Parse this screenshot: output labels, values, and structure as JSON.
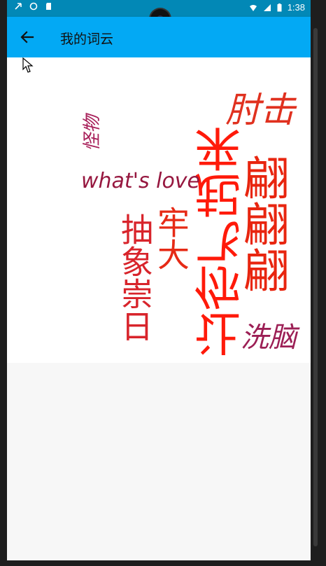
{
  "status_bar": {
    "time": "1:38"
  },
  "app_bar": {
    "title": "我的词云"
  },
  "word_cloud": {
    "words": [
      {
        "text": "肘击",
        "color": "#e0311f"
      },
      {
        "text": "怪物",
        "color": "#a8205a"
      },
      {
        "text": "让你飞起来",
        "color": "#ff1a0a"
      },
      {
        "text": "what's love",
        "color": "#96173f"
      },
      {
        "text": "翩翩翩",
        "color": "#e8250f"
      },
      {
        "text": "牢大",
        "color": "#e62a16"
      },
      {
        "text": "抽象崇日",
        "color": "#d8242b"
      },
      {
        "text": "洗脑",
        "color": "#9c1f55"
      }
    ]
  }
}
